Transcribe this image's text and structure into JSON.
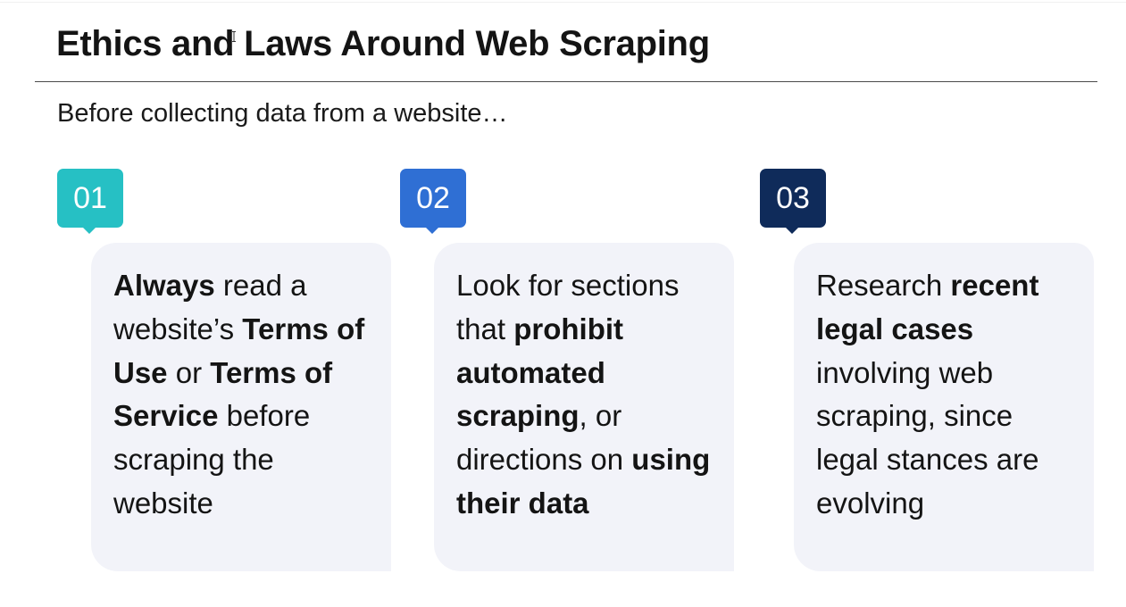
{
  "slide": {
    "title": "Ethics and Laws Around Web Scraping",
    "subtitle": "Before collecting data from a website…"
  },
  "steps": [
    {
      "number": "01",
      "color": "#26c0c4",
      "segments": [
        {
          "text": "Always",
          "bold": true
        },
        {
          "text": " read a website’s ",
          "bold": false
        },
        {
          "text": "Terms of Use",
          "bold": true
        },
        {
          "text": " or ",
          "bold": false
        },
        {
          "text": "Terms of Service",
          "bold": true
        },
        {
          "text": " before scraping the website",
          "bold": false
        }
      ]
    },
    {
      "number": "02",
      "color": "#2f6fd4",
      "segments": [
        {
          "text": "Look for sections that ",
          "bold": false
        },
        {
          "text": "prohibit automated scraping",
          "bold": true
        },
        {
          "text": ", or directions on ",
          "bold": false
        },
        {
          "text": "using their data",
          "bold": true
        }
      ]
    },
    {
      "number": "03",
      "color": "#0f2b5a",
      "segments": [
        {
          "text": "Research ",
          "bold": false
        },
        {
          "text": "recent legal cases",
          "bold": true
        },
        {
          "text": " involving web scraping, since legal stances are evolving",
          "bold": false
        }
      ]
    }
  ]
}
